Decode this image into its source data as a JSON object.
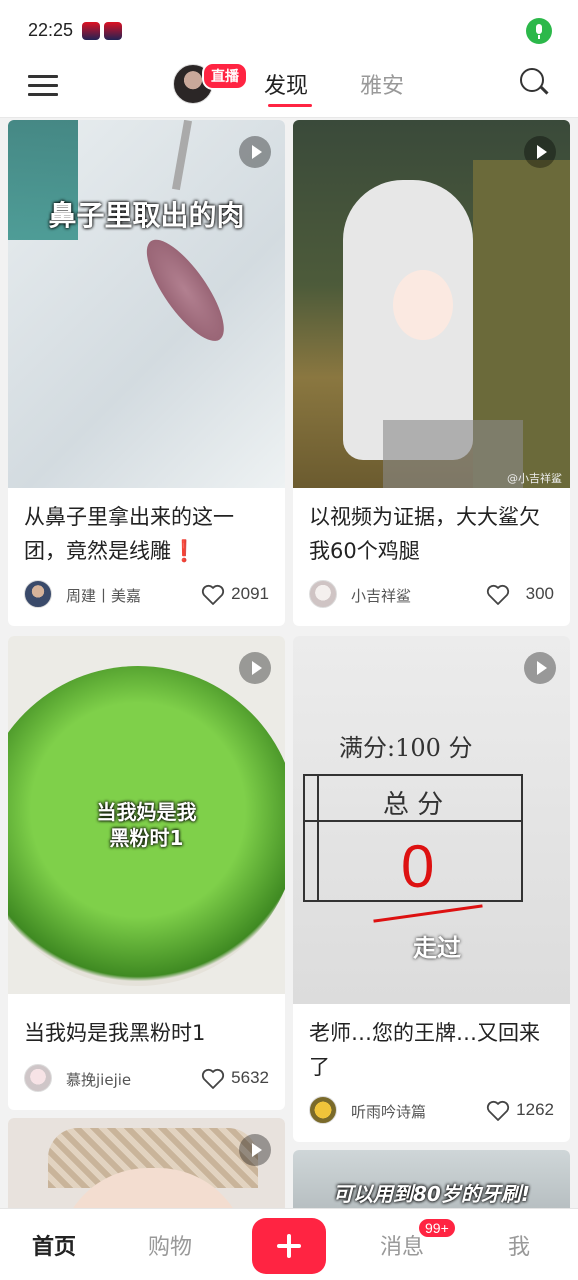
{
  "status_bar": {
    "time": "22:25"
  },
  "header": {
    "live_label": "直播",
    "tabs": [
      {
        "label": "发现",
        "active": true
      },
      {
        "label": "雅安",
        "active": false
      }
    ]
  },
  "feed": [
    {
      "title": "从鼻子里拿出来的这一团，竟然是线雕❗",
      "cover_text": "鼻子里取出的肉",
      "author": "周建丨美嘉",
      "likes": "2091",
      "is_video": true
    },
    {
      "title": "以视频为证据，大大鲨欠我60个鸡腿",
      "cover_text": "",
      "watermark": "@小吉祥鲨",
      "author": "小吉祥鲨",
      "likes": "300",
      "is_video": true
    },
    {
      "title": "当我妈是我黑粉时1",
      "cover_text_line1": "当我妈是我",
      "cover_text_line2": "黑粉时1",
      "author": "慕挽jiejie",
      "likes": "5632",
      "is_video": true
    },
    {
      "title": "老师…您的王牌…又回来了",
      "cover_text_line1": "满分:100 分",
      "cover_text_line2": "总 分",
      "cover_text_line3": "0",
      "cover_text_line4": "走过",
      "author": "听雨吟诗篇",
      "likes": "1262",
      "is_video": true
    },
    {
      "title": "",
      "cover_text": "",
      "author": "",
      "likes": "",
      "is_video": true
    },
    {
      "title": "",
      "cover_text": "可以用到80岁的牙刷!",
      "author": "",
      "likes": "",
      "is_video": false
    }
  ],
  "tabbar": {
    "home": "首页",
    "shop": "购物",
    "messages": "消息",
    "messages_badge": "99+",
    "me": "我"
  },
  "colors": {
    "accent": "#ff2442",
    "mic": "#2cb84a"
  }
}
